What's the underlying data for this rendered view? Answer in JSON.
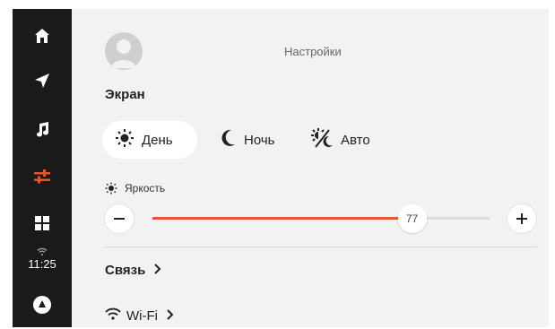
{
  "sidebar": {
    "items": [
      {
        "icon": "home-icon"
      },
      {
        "icon": "navigation-icon"
      },
      {
        "icon": "music-icon"
      },
      {
        "icon": "settings-sliders-icon",
        "active": true
      },
      {
        "icon": "apps-grid-icon"
      }
    ],
    "clock": "11:25",
    "assistant_icon": "alice-assistant-icon"
  },
  "header": {
    "title": "Настройки"
  },
  "screen": {
    "section_title": "Экран",
    "modes": [
      {
        "label": "День",
        "icon": "sun-icon",
        "selected": true
      },
      {
        "label": "Ночь",
        "icon": "moon-icon",
        "selected": false
      },
      {
        "label": "Авто",
        "icon": "auto-brightness-icon",
        "selected": false
      }
    ],
    "brightness": {
      "label": "Яркость",
      "value": "77",
      "fraction": 0.77
    }
  },
  "links": {
    "connection": "Связь",
    "wifi": "Wi-Fi"
  },
  "colors": {
    "accent": "#e8552d",
    "sidebar_bg": "#1a1a1a",
    "content_bg": "#f2f2f2"
  }
}
